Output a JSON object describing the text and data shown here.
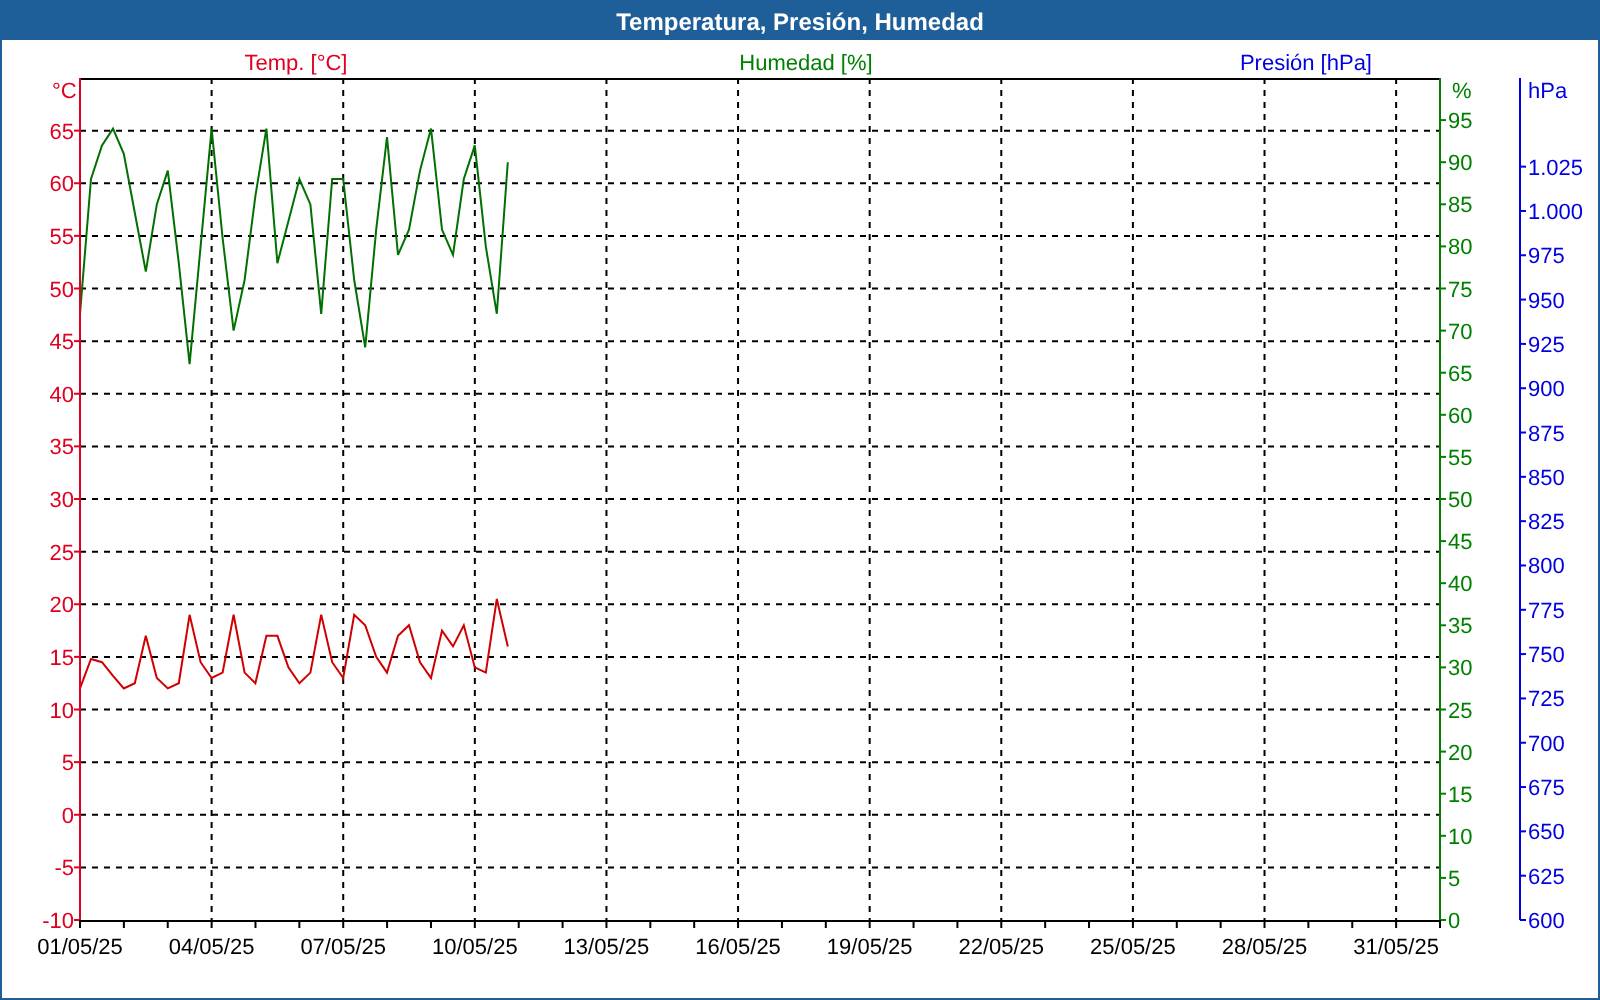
{
  "window": {
    "title": "Temperatura, Presión, Humedad"
  },
  "chart": {
    "pressure_title": {
      "text": "Presión [hPa]"
    },
    "axes": [
      {
        "unit": "°C",
        "color": "#e00020"
      },
      {
        "unit": "%",
        "color": "#008000"
      },
      {
        "unit": "hPa",
        "color": "#0000e0",
        "ticks": [
          "1.025",
          "1.000",
          "975",
          "950",
          "925",
          "900",
          "875",
          "850",
          "825",
          "800",
          "775",
          "750",
          "725",
          "700",
          "675",
          "650",
          "625",
          "600"
        ]
      }
    ],
    "chart_data": {
      "type": "line",
      "grid": true,
      "ylim": [
        -10,
        70
      ],
      "y2lim": [
        0,
        100
      ],
      "y2ticks": [
        0,
        5,
        10,
        15,
        20,
        25,
        30,
        35,
        40,
        45,
        50,
        55,
        60,
        65,
        70,
        75,
        80,
        85,
        90,
        95
      ],
      "yticks": [
        -10,
        -5,
        0,
        5,
        10,
        15,
        20,
        25,
        30,
        35,
        40,
        45,
        50,
        55,
        60,
        65
      ],
      "categories": [
        "01/05/25",
        null,
        null,
        null,
        null,
        null,
        null,
        null,
        null,
        null,
        null,
        null,
        "04/05/25",
        null,
        null,
        null,
        null,
        null,
        null,
        null,
        null,
        null,
        null,
        null,
        "07/05/25",
        null,
        null,
        null,
        null,
        null,
        null,
        null,
        null,
        null,
        null,
        null,
        "10/05/25",
        null,
        null,
        null,
        null,
        null,
        null,
        null,
        null,
        null,
        null,
        null,
        "13/05/25",
        null,
        null,
        null,
        null,
        null,
        null,
        null,
        null,
        null,
        null,
        null,
        "16/05/25",
        null,
        null,
        null,
        null,
        null,
        null,
        null,
        null,
        null,
        null,
        null,
        "19/05/25",
        null,
        null,
        null,
        null,
        null,
        null,
        null,
        null,
        null,
        null,
        null,
        "22/05/25",
        null,
        null,
        null,
        null,
        null,
        null,
        null,
        null,
        null,
        null,
        null,
        "25/05/25",
        null,
        null,
        null,
        null,
        null,
        null,
        null,
        null,
        null,
        null,
        null,
        "28/05/25",
        null,
        null,
        null,
        null,
        null,
        null,
        null,
        null,
        null,
        null,
        null,
        "31/05/25",
        null,
        null,
        null
      ],
      "series": [
        {
          "name": "Temp. [°C]",
          "color": "#d00000",
          "values": [
            12,
            14.8,
            14.5,
            13.2,
            12,
            12.5,
            17,
            13,
            12,
            12.5,
            19,
            14.5,
            13,
            13.5,
            19,
            13.5,
            12.5,
            17,
            17,
            14,
            12.5,
            13.5,
            19,
            14.5,
            13,
            19,
            18,
            15,
            13.5,
            17,
            18,
            14.5,
            13,
            17.5,
            16,
            18,
            14,
            13.5,
            20.5,
            16,
            null,
            null,
            null,
            null,
            null,
            null,
            null,
            null,
            null,
            null,
            null,
            null,
            null,
            null,
            null,
            null,
            null,
            null,
            null,
            null,
            null,
            null,
            null,
            null,
            null,
            null,
            null,
            null,
            null,
            null,
            null,
            null,
            null,
            null,
            null,
            null,
            null,
            null,
            null,
            null,
            null,
            null,
            null,
            null,
            null,
            null,
            null,
            null,
            null,
            null,
            null,
            null,
            null,
            null,
            null,
            null,
            null,
            null,
            null,
            null,
            null,
            null,
            null,
            null,
            null,
            null,
            null,
            null,
            null,
            null,
            null,
            null,
            null,
            null,
            null,
            null,
            null,
            null,
            null,
            null,
            null,
            null,
            null,
            null
          ]
        },
        {
          "name": "Humedad [%]",
          "color": "#007000",
          "axis": "y2",
          "values": [
            72,
            88,
            92,
            94,
            91,
            84,
            77,
            85,
            89,
            78,
            66,
            80,
            94,
            81,
            70,
            76,
            86,
            94,
            78,
            83,
            88,
            85,
            72,
            88,
            88,
            76,
            68,
            82,
            93,
            79,
            82,
            89,
            94,
            82,
            79,
            88,
            92,
            80,
            72,
            90,
            null,
            null,
            null,
            null,
            null,
            null,
            null,
            null,
            null,
            null,
            null,
            null,
            null,
            null,
            null,
            null,
            null,
            null,
            null,
            null,
            null,
            null,
            null,
            null,
            null,
            null,
            null,
            null,
            null,
            null,
            null,
            null,
            null,
            null,
            null,
            null,
            null,
            null,
            null,
            null,
            null,
            null,
            null,
            null,
            null,
            null,
            null,
            null,
            null,
            null,
            null,
            null,
            null,
            null,
            null,
            null,
            null,
            null,
            null,
            null,
            null,
            null,
            null,
            null,
            null,
            null,
            null,
            null,
            null,
            null,
            null,
            null,
            null,
            null,
            null,
            null,
            null,
            null,
            null,
            null,
            null,
            null,
            null,
            null
          ]
        }
      ]
    }
  }
}
